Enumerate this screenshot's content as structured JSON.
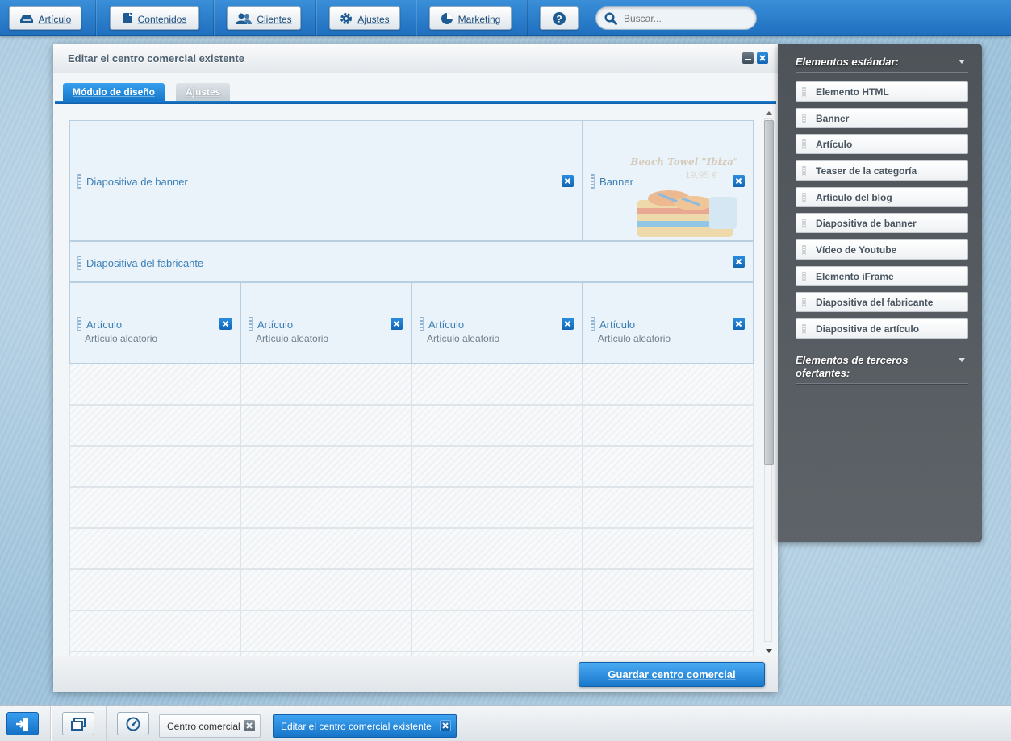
{
  "toolbar": {
    "buttons": [
      {
        "label": "Artículo",
        "icon": "product-icon"
      },
      {
        "label": "Contenidos",
        "icon": "content-icon"
      },
      {
        "label": "Clientes",
        "icon": "customers-icon"
      },
      {
        "label": "Ajustes",
        "icon": "settings-icon"
      },
      {
        "label": "Marketing",
        "icon": "marketing-icon"
      },
      {
        "label": "",
        "icon": "help-icon"
      }
    ],
    "search_placeholder": "Buscar..."
  },
  "window": {
    "title": "Editar el centro comercial existente",
    "tabs": [
      "Módulo de diseño",
      "Ajustes"
    ],
    "save_label": "Guardar centro comercial"
  },
  "layout_blocks": {
    "banner_slide": {
      "title": "Diapositiva de banner"
    },
    "banner": {
      "title": "Banner",
      "promo_line1": "Beach Towel \"Ibiza\"",
      "promo_line2": "19,95 €"
    },
    "manufacturer_slide": {
      "title": "Diapositiva del fabricante"
    },
    "articles": [
      {
        "title": "Artículo",
        "subtitle": "Artículo aleatorio"
      },
      {
        "title": "Artículo",
        "subtitle": "Artículo aleatorio"
      },
      {
        "title": "Artículo",
        "subtitle": "Artículo aleatorio"
      },
      {
        "title": "Artículo",
        "subtitle": "Artículo aleatorio"
      }
    ]
  },
  "side_panel": {
    "standard_heading": "Elementos estándar:",
    "standard_items": [
      "Elemento HTML",
      "Banner",
      "Artículo",
      "Teaser de la categoría",
      "Artículo del blog",
      "Diapositiva de banner",
      "Vídeo de Youtube",
      "Elemento iFrame",
      "Diapositiva del fabricante",
      "Diapositiva de artículo"
    ],
    "third_party_heading": "Elementos de terceros ofertantes:"
  },
  "taskbar": {
    "tasks": [
      {
        "label": "Centro comercial",
        "active": false
      },
      {
        "label": "Editar el centro comercial existente",
        "active": true
      }
    ]
  },
  "colors": {
    "accent": "#1a78cc",
    "panel_dark": "#53595e",
    "block_bg": "#eaf3fa"
  }
}
